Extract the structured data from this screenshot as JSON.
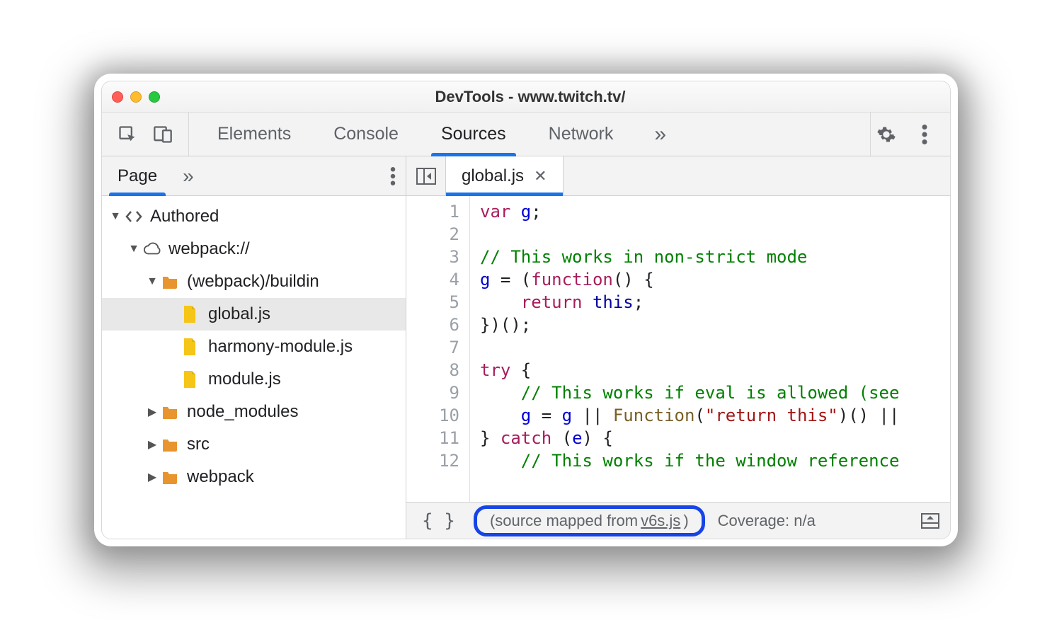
{
  "window": {
    "title": "DevTools - www.twitch.tv/"
  },
  "topTabs": {
    "items": [
      "Elements",
      "Console",
      "Sources",
      "Network"
    ],
    "activeIndex": 2,
    "more": "»"
  },
  "leftPane": {
    "tabs": {
      "items": [
        "Page"
      ],
      "activeIndex": 0,
      "more": "»"
    },
    "tree": [
      {
        "depth": 0,
        "twisty": "▼",
        "icon": "code",
        "label": "Authored"
      },
      {
        "depth": 1,
        "twisty": "▼",
        "icon": "cloud",
        "label": "webpack://"
      },
      {
        "depth": 2,
        "twisty": "▼",
        "icon": "folder",
        "label": "(webpack)/buildin"
      },
      {
        "depth": 3,
        "twisty": "",
        "icon": "file",
        "label": "global.js",
        "selected": true
      },
      {
        "depth": 3,
        "twisty": "",
        "icon": "file",
        "label": "harmony-module.js"
      },
      {
        "depth": 3,
        "twisty": "",
        "icon": "file",
        "label": "module.js"
      },
      {
        "depth": 2,
        "twisty": "▶",
        "icon": "folder",
        "label": "node_modules"
      },
      {
        "depth": 2,
        "twisty": "▶",
        "icon": "folder",
        "label": "src"
      },
      {
        "depth": 2,
        "twisty": "▶",
        "icon": "folder",
        "label": "webpack"
      }
    ]
  },
  "editor": {
    "openFile": "global.js",
    "lineCount": 12,
    "lines": [
      [
        {
          "t": "var ",
          "c": "kw"
        },
        {
          "t": "g",
          "c": "id"
        },
        {
          "t": ";",
          "c": "pn"
        }
      ],
      [
        {
          "t": "",
          "c": "pn"
        }
      ],
      [
        {
          "t": "// This works in non-strict mode",
          "c": "cm"
        }
      ],
      [
        {
          "t": "g",
          "c": "id"
        },
        {
          "t": " = (",
          "c": "pn"
        },
        {
          "t": "function",
          "c": "kw"
        },
        {
          "t": "() {",
          "c": "pn"
        }
      ],
      [
        {
          "t": "    ",
          "c": "pn"
        },
        {
          "t": "return ",
          "c": "kw"
        },
        {
          "t": "this",
          "c": "th"
        },
        {
          "t": ";",
          "c": "pn"
        }
      ],
      [
        {
          "t": "})();",
          "c": "pn"
        }
      ],
      [
        {
          "t": "",
          "c": "pn"
        }
      ],
      [
        {
          "t": "try ",
          "c": "kw"
        },
        {
          "t": "{",
          "c": "pn"
        }
      ],
      [
        {
          "t": "    ",
          "c": "pn"
        },
        {
          "t": "// This works if eval is allowed (see",
          "c": "cm"
        }
      ],
      [
        {
          "t": "    ",
          "c": "pn"
        },
        {
          "t": "g",
          "c": "id"
        },
        {
          "t": " = ",
          "c": "pn"
        },
        {
          "t": "g",
          "c": "id"
        },
        {
          "t": " || ",
          "c": "pn"
        },
        {
          "t": "Function",
          "c": "fn"
        },
        {
          "t": "(",
          "c": "pn"
        },
        {
          "t": "\"return this\"",
          "c": "st"
        },
        {
          "t": ")() ||",
          "c": "pn"
        }
      ],
      [
        {
          "t": "} ",
          "c": "pn"
        },
        {
          "t": "catch ",
          "c": "kw"
        },
        {
          "t": "(",
          "c": "pn"
        },
        {
          "t": "e",
          "c": "id"
        },
        {
          "t": ") {",
          "c": "pn"
        }
      ],
      [
        {
          "t": "    ",
          "c": "pn"
        },
        {
          "t": "// This works if the window reference",
          "c": "cm"
        }
      ]
    ]
  },
  "statusbar": {
    "braces": "{ }",
    "mapped_prefix": "(source mapped from ",
    "mapped_link": "v6s.js",
    "mapped_suffix": ")",
    "coverage": "Coverage: n/a"
  }
}
